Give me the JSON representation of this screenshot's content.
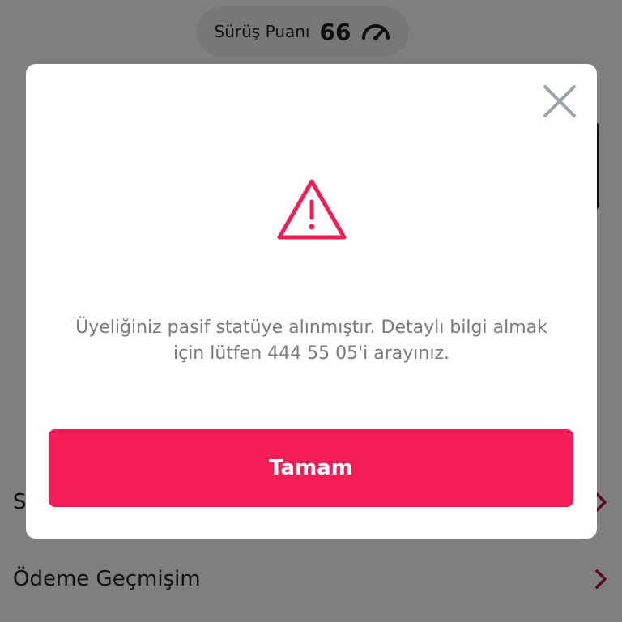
{
  "header": {
    "score_label": "Sürüş Puanı",
    "score_value": "66",
    "gauge_icon": "gauge-icon"
  },
  "menu": {
    "items": [
      {
        "label": "S",
        "icon": "chevron-right-icon"
      },
      {
        "label": "Ödeme Geçmişim",
        "icon": "chevron-right-icon"
      }
    ]
  },
  "modal": {
    "close_icon": "close-icon",
    "warning_icon": "warning-icon",
    "message": "Üyeliğiniz pasif statüye alınmıştır. Detaylı bilgi almak için lütfen 444 55 05'i arayınız.",
    "ok_label": "Tamam"
  },
  "colors": {
    "accent": "#f41c54",
    "overlay": "rgba(0,0,0,0.5)",
    "message_text": "#7a7a7a"
  }
}
